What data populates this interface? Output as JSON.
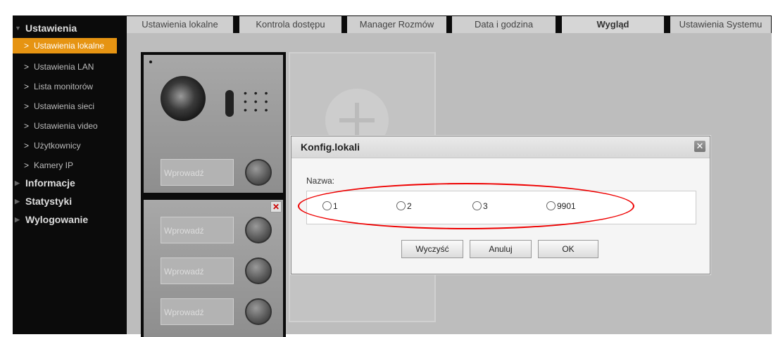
{
  "sidebar": {
    "settings_header": "Ustawienia",
    "items": [
      {
        "label": "Ustawienia lokalne",
        "active": true
      },
      {
        "label": "Ustawienia LAN"
      },
      {
        "label": "Lista monitorów"
      },
      {
        "label": "Ustawienia sieci"
      },
      {
        "label": "Ustawienia video"
      },
      {
        "label": "Użytkownicy"
      },
      {
        "label": "Kamery IP"
      }
    ],
    "sections": [
      {
        "label": "Informacje"
      },
      {
        "label": "Statystyki"
      },
      {
        "label": "Wylogowanie"
      }
    ]
  },
  "tabs": [
    {
      "label": "Ustawienia lokalne"
    },
    {
      "label": "Kontrola dostępu"
    },
    {
      "label": "Manager Rozmów"
    },
    {
      "label": "Data i godzina"
    },
    {
      "label": "Wygląd",
      "active": true
    },
    {
      "label": "Ustawienia Systemu"
    }
  ],
  "device": {
    "input_placeholder": "Wprowadź"
  },
  "dialog": {
    "title": "Konfig.lokali",
    "field_label": "Nazwa:",
    "options": [
      "1",
      "2",
      "3",
      "9901"
    ],
    "buttons": {
      "clear": "Wyczyść",
      "cancel": "Anuluj",
      "ok": "OK"
    }
  },
  "colors": {
    "accent": "#e69412",
    "highlight_ring": "#e00000",
    "sidebar_bg": "#0b0b0b",
    "content_bg": "#bdbdbd"
  }
}
